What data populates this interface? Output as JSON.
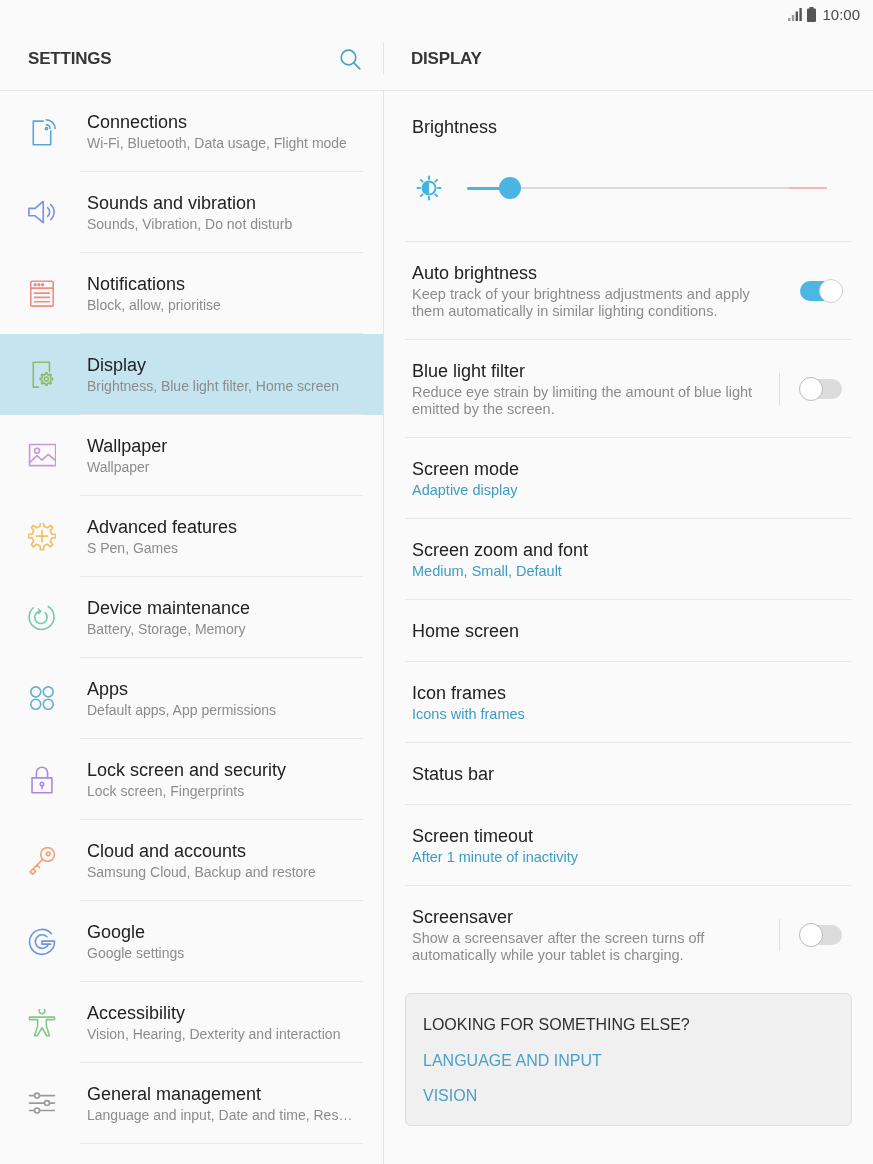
{
  "status_bar": {
    "time": "10:00"
  },
  "master_header": {
    "title": "SETTINGS"
  },
  "settings_menu": [
    {
      "title": "Connections",
      "subtitle": "Wi-Fi, Bluetooth, Data usage, Flight mode",
      "selected": false
    },
    {
      "title": "Sounds and vibration",
      "subtitle": "Sounds, Vibration, Do not disturb",
      "selected": false
    },
    {
      "title": "Notifications",
      "subtitle": "Block, allow, prioritise",
      "selected": false
    },
    {
      "title": "Display",
      "subtitle": "Brightness, Blue light filter, Home screen",
      "selected": true
    },
    {
      "title": "Wallpaper",
      "subtitle": "Wallpaper",
      "selected": false
    },
    {
      "title": "Advanced features",
      "subtitle": "S Pen, Games",
      "selected": false
    },
    {
      "title": "Device maintenance",
      "subtitle": "Battery, Storage, Memory",
      "selected": false
    },
    {
      "title": "Apps",
      "subtitle": "Default apps, App permissions",
      "selected": false
    },
    {
      "title": "Lock screen and security",
      "subtitle": "Lock screen, Fingerprints",
      "selected": false
    },
    {
      "title": "Cloud and accounts",
      "subtitle": "Samsung Cloud, Backup and restore",
      "selected": false
    },
    {
      "title": "Google",
      "subtitle": "Google settings",
      "selected": false
    },
    {
      "title": "Accessibility",
      "subtitle": "Vision, Hearing, Dexterity and interaction",
      "selected": false
    },
    {
      "title": "General management",
      "subtitle": "Language and input, Date and time, Res…",
      "selected": false
    }
  ],
  "detail_header": {
    "title": "DISPLAY"
  },
  "brightness": {
    "title": "Brightness",
    "level": 0.12
  },
  "display_settings": [
    {
      "kind": "toggle",
      "title": "Auto brightness",
      "description": "Keep track of your brightness adjustments and apply them automatically in similar lighting conditions.",
      "on": true
    },
    {
      "kind": "split_toggle",
      "title": "Blue light filter",
      "description": "Reduce eye strain by limiting the amount of blue light emitted by the screen.",
      "on": false
    },
    {
      "kind": "value",
      "title": "Screen mode",
      "value": "Adaptive display"
    },
    {
      "kind": "value",
      "title": "Screen zoom and font",
      "value": "Medium, Small, Default"
    },
    {
      "kind": "plain",
      "title": "Home screen"
    },
    {
      "kind": "value",
      "title": "Icon frames",
      "value": "Icons with frames"
    },
    {
      "kind": "plain",
      "title": "Status bar"
    },
    {
      "kind": "value",
      "title": "Screen timeout",
      "value": "After 1 minute of inactivity"
    },
    {
      "kind": "split_toggle",
      "title": "Screensaver",
      "description": "Show a screensaver after the screen turns off automatically while your tablet is charging.",
      "on": false
    }
  ],
  "suggestions": {
    "title": "LOOKING FOR SOMETHING ELSE?",
    "links": [
      "LANGUAGE AND INPUT",
      "VISION"
    ]
  }
}
